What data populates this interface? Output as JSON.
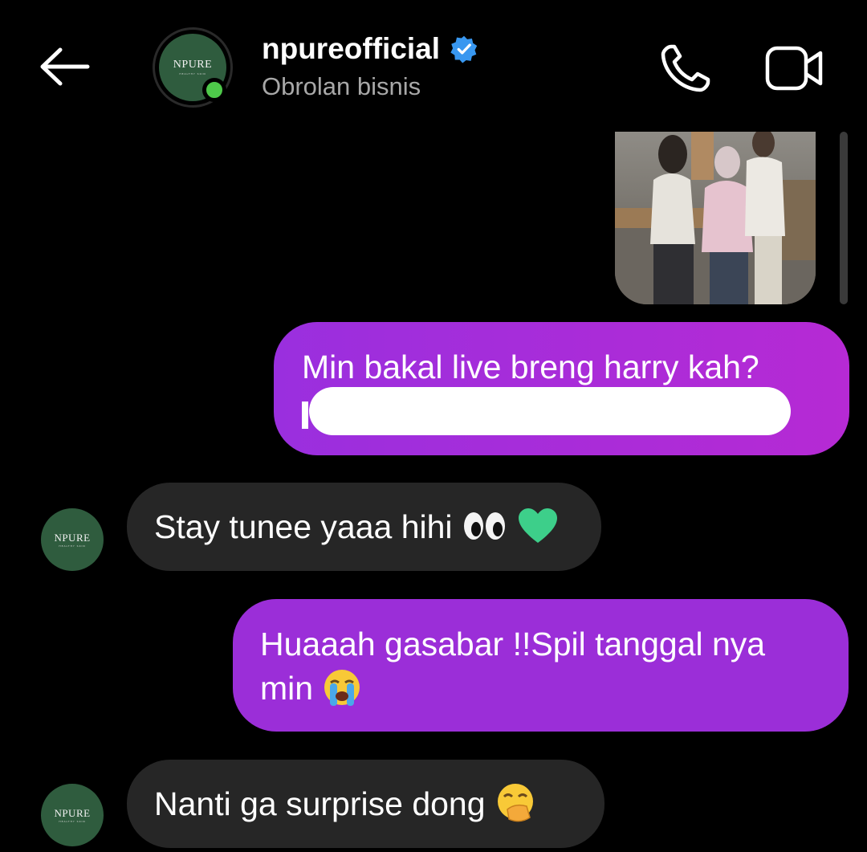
{
  "header": {
    "username": "npureofficial",
    "subtitle": "Obrolan bisnis",
    "avatar_logo": "NPURE",
    "avatar_logo_sub": "HEALTHY SKIN",
    "verified": true,
    "online": true,
    "icons": {
      "back": "back-arrow-icon",
      "verified": "verified-badge-icon",
      "call": "phone-icon",
      "video": "video-camera-icon"
    }
  },
  "messages": [
    {
      "from": "me",
      "type": "image"
    },
    {
      "from": "me",
      "type": "text",
      "line1": "Min bakal live breng harry kah?",
      "line2_first_char": "k",
      "redacted": true
    },
    {
      "from": "them",
      "type": "text",
      "text": "Stay tunee yaaa hihi",
      "emojis": [
        "eyes",
        "green-heart"
      ]
    },
    {
      "from": "me",
      "type": "text",
      "line1": "Huaaah gasabar !!Spil tanggal nya",
      "line2": "min",
      "emojis": [
        "loudly-crying-face"
      ]
    },
    {
      "from": "them",
      "type": "text",
      "text": "Nanti ga surprise dong",
      "emojis": [
        "face-with-hand-over-mouth"
      ]
    }
  ],
  "colors": {
    "outgoing_bubble": "#9b2ed8",
    "incoming_bubble": "#262626",
    "background": "#000000",
    "avatar": "#2f5c3e",
    "online": "#4ec94a",
    "verified": "#3897f0"
  }
}
